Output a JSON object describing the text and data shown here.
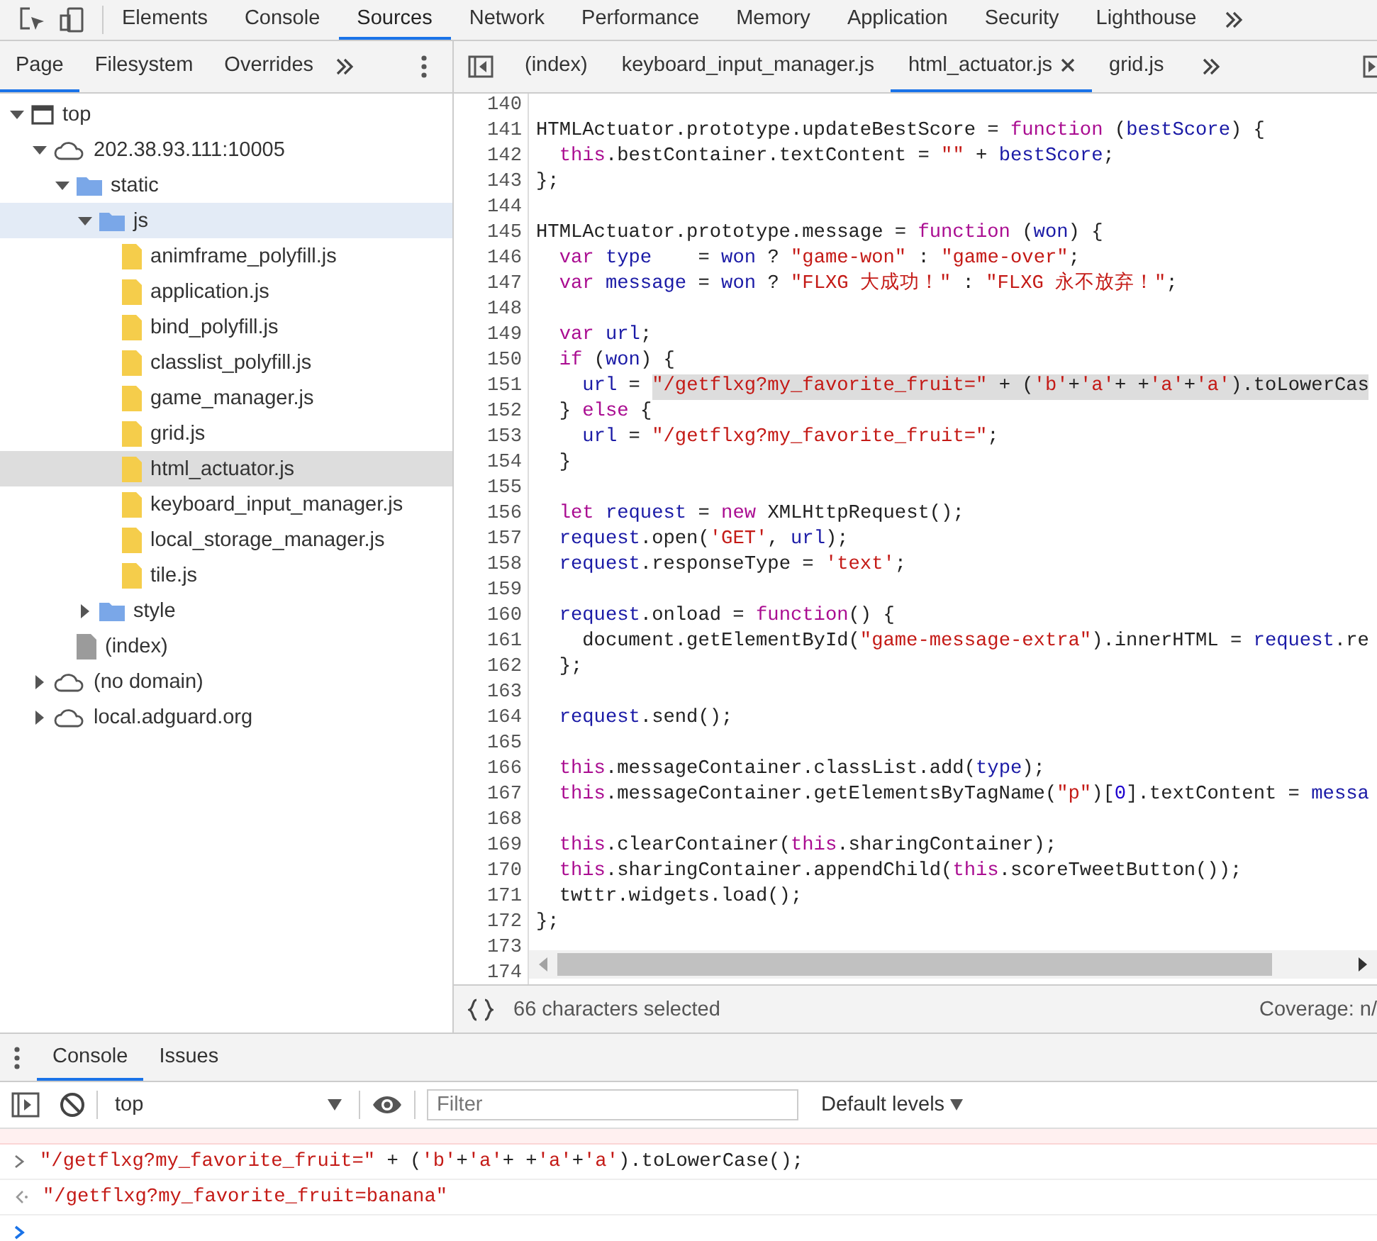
{
  "toolbar": {
    "tabs": [
      {
        "label": "Elements",
        "selected": false
      },
      {
        "label": "Console",
        "selected": false
      },
      {
        "label": "Sources",
        "selected": true
      },
      {
        "label": "Network",
        "selected": false
      },
      {
        "label": "Performance",
        "selected": false
      },
      {
        "label": "Memory",
        "selected": false
      },
      {
        "label": "Application",
        "selected": false
      },
      {
        "label": "Security",
        "selected": false
      },
      {
        "label": "Lighthouse",
        "selected": false
      }
    ]
  },
  "navigator": {
    "tabs": [
      {
        "label": "Page",
        "selected": true
      },
      {
        "label": "Filesystem",
        "selected": false
      },
      {
        "label": "Overrides",
        "selected": false
      }
    ],
    "tree": [
      {
        "label": "top",
        "kind": "frame",
        "expanded": true,
        "selected": false,
        "highlighted": false,
        "children": [
          {
            "label": "202.38.93.111:10005",
            "kind": "domain",
            "expanded": true,
            "selected": false,
            "highlighted": false,
            "children": [
              {
                "label": "static",
                "kind": "folder",
                "expanded": true,
                "selected": false,
                "highlighted": false,
                "children": [
                  {
                    "label": "js",
                    "kind": "folder",
                    "expanded": true,
                    "selected": false,
                    "highlighted": true,
                    "children": [
                      {
                        "label": "animframe_polyfill.js",
                        "kind": "file",
                        "selected": false,
                        "highlighted": false
                      },
                      {
                        "label": "application.js",
                        "kind": "file",
                        "selected": false,
                        "highlighted": false
                      },
                      {
                        "label": "bind_polyfill.js",
                        "kind": "file",
                        "selected": false,
                        "highlighted": false
                      },
                      {
                        "label": "classlist_polyfill.js",
                        "kind": "file",
                        "selected": false,
                        "highlighted": false
                      },
                      {
                        "label": "game_manager.js",
                        "kind": "file",
                        "selected": false,
                        "highlighted": false
                      },
                      {
                        "label": "grid.js",
                        "kind": "file",
                        "selected": false,
                        "highlighted": false
                      },
                      {
                        "label": "html_actuator.js",
                        "kind": "file",
                        "selected": true,
                        "highlighted": false
                      },
                      {
                        "label": "keyboard_input_manager.js",
                        "kind": "file",
                        "selected": false,
                        "highlighted": false
                      },
                      {
                        "label": "local_storage_manager.js",
                        "kind": "file",
                        "selected": false,
                        "highlighted": false
                      },
                      {
                        "label": "tile.js",
                        "kind": "file",
                        "selected": false,
                        "highlighted": false
                      }
                    ]
                  },
                  {
                    "label": "style",
                    "kind": "folder",
                    "expanded": false,
                    "selected": false,
                    "highlighted": false
                  }
                ]
              },
              {
                "label": "(index)",
                "kind": "document",
                "selected": false,
                "highlighted": false
              }
            ]
          },
          {
            "label": "(no domain)",
            "kind": "domain",
            "expanded": false,
            "selected": false,
            "highlighted": false
          },
          {
            "label": "local.adguard.org",
            "kind": "domain",
            "expanded": false,
            "selected": false,
            "highlighted": false
          }
        ]
      }
    ]
  },
  "editor": {
    "tabs": [
      {
        "label": "(index)",
        "selected": false
      },
      {
        "label": "keyboard_input_manager.js",
        "selected": false
      },
      {
        "label": "html_actuator.js",
        "selected": true
      },
      {
        "label": "grid.js",
        "selected": false
      }
    ],
    "lines": [
      {
        "number": "140"
      },
      {
        "number": "141",
        "tokens": [
          {
            "kind": "plain",
            "text": "HTMLActuator.prototype.updateBestScore = "
          },
          {
            "kind": "keyword",
            "text": "function"
          },
          {
            "kind": "plain",
            "text": " ("
          },
          {
            "kind": "name",
            "text": "bestScore"
          },
          {
            "kind": "plain",
            "text": ") {"
          }
        ]
      },
      {
        "number": "142",
        "tokens": [
          {
            "kind": "keyword",
            "text": "  this"
          },
          {
            "kind": "plain",
            "text": ".bestContainer.textContent = "
          },
          {
            "kind": "string",
            "text": "\"\""
          },
          {
            "kind": "plain",
            "text": " + "
          },
          {
            "kind": "name",
            "text": "bestScore"
          },
          {
            "kind": "plain",
            "text": ";"
          }
        ]
      },
      {
        "number": "143",
        "tokens": [
          {
            "kind": "plain",
            "text": "};"
          }
        ]
      },
      {
        "number": "144"
      },
      {
        "number": "145",
        "tokens": [
          {
            "kind": "plain",
            "text": "HTMLActuator.prototype.message = "
          },
          {
            "kind": "keyword",
            "text": "function"
          },
          {
            "kind": "plain",
            "text": " ("
          },
          {
            "kind": "name",
            "text": "won"
          },
          {
            "kind": "plain",
            "text": ") {"
          }
        ]
      },
      {
        "number": "146",
        "tokens": [
          {
            "kind": "keyword",
            "text": "  var"
          },
          {
            "kind": "name",
            "text": " type"
          },
          {
            "kind": "plain",
            "text": "    = "
          },
          {
            "kind": "name",
            "text": "won"
          },
          {
            "kind": "plain",
            "text": " ? "
          },
          {
            "kind": "string",
            "text": "\"game-won\""
          },
          {
            "kind": "plain",
            "text": " : "
          },
          {
            "kind": "string",
            "text": "\"game-over\""
          },
          {
            "kind": "plain",
            "text": ";"
          }
        ]
      },
      {
        "number": "147",
        "tokens": [
          {
            "kind": "keyword",
            "text": "  var"
          },
          {
            "kind": "name",
            "text": " message"
          },
          {
            "kind": "plain",
            "text": " = "
          },
          {
            "kind": "name",
            "text": "won"
          },
          {
            "kind": "plain",
            "text": " ? "
          },
          {
            "kind": "string",
            "text": "\"FLXG 大成功！\""
          },
          {
            "kind": "plain",
            "text": " : "
          },
          {
            "kind": "string",
            "text": "\"FLXG 永不放弃！\""
          },
          {
            "kind": "plain",
            "text": ";"
          }
        ]
      },
      {
        "number": "148"
      },
      {
        "number": "149",
        "tokens": [
          {
            "kind": "keyword",
            "text": "  var"
          },
          {
            "kind": "name",
            "text": " url"
          },
          {
            "kind": "plain",
            "text": ";"
          }
        ]
      },
      {
        "number": "150",
        "tokens": [
          {
            "kind": "keyword",
            "text": "  if"
          },
          {
            "kind": "plain",
            "text": " ("
          },
          {
            "kind": "name",
            "text": "won"
          },
          {
            "kind": "plain",
            "text": ") {"
          }
        ]
      },
      {
        "number": "151",
        "tokens": [
          {
            "kind": "name",
            "text": "    url"
          },
          {
            "kind": "plain",
            "text": " = "
          }
        ],
        "selected_tokens": [
          {
            "kind": "string",
            "text": "\"/getflxg?my_favorite_fruit=\""
          },
          {
            "kind": "plain",
            "text": " + ("
          },
          {
            "kind": "string",
            "text": "'b'"
          },
          {
            "kind": "plain",
            "text": "+"
          },
          {
            "kind": "string",
            "text": "'a'"
          },
          {
            "kind": "plain",
            "text": "+ +"
          },
          {
            "kind": "string",
            "text": "'a'"
          },
          {
            "kind": "plain",
            "text": "+"
          },
          {
            "kind": "string",
            "text": "'a'"
          },
          {
            "kind": "plain",
            "text": ").toLowerCas"
          }
        ]
      },
      {
        "number": "152",
        "tokens": [
          {
            "kind": "plain",
            "text": "  } "
          },
          {
            "kind": "keyword",
            "text": "else"
          },
          {
            "kind": "plain",
            "text": " {"
          }
        ]
      },
      {
        "number": "153",
        "tokens": [
          {
            "kind": "name",
            "text": "    url"
          },
          {
            "kind": "plain",
            "text": " = "
          },
          {
            "kind": "string",
            "text": "\"/getflxg?my_favorite_fruit=\""
          },
          {
            "kind": "plain",
            "text": ";"
          }
        ]
      },
      {
        "number": "154",
        "tokens": [
          {
            "kind": "plain",
            "text": "  }"
          }
        ]
      },
      {
        "number": "155"
      },
      {
        "number": "156",
        "tokens": [
          {
            "kind": "keyword",
            "text": "  let"
          },
          {
            "kind": "name",
            "text": " request"
          },
          {
            "kind": "plain",
            "text": " = "
          },
          {
            "kind": "keyword",
            "text": "new"
          },
          {
            "kind": "plain",
            "text": " XMLHttpRequest();"
          }
        ]
      },
      {
        "number": "157",
        "tokens": [
          {
            "kind": "name",
            "text": "  request"
          },
          {
            "kind": "plain",
            "text": ".open("
          },
          {
            "kind": "string",
            "text": "'GET'"
          },
          {
            "kind": "plain",
            "text": ", "
          },
          {
            "kind": "name",
            "text": "url"
          },
          {
            "kind": "plain",
            "text": ");"
          }
        ]
      },
      {
        "number": "158",
        "tokens": [
          {
            "kind": "name",
            "text": "  request"
          },
          {
            "kind": "plain",
            "text": ".responseType = "
          },
          {
            "kind": "string",
            "text": "'text'"
          },
          {
            "kind": "plain",
            "text": ";"
          }
        ]
      },
      {
        "number": "159"
      },
      {
        "number": "160",
        "tokens": [
          {
            "kind": "name",
            "text": "  request"
          },
          {
            "kind": "plain",
            "text": ".onload = "
          },
          {
            "kind": "keyword",
            "text": "function"
          },
          {
            "kind": "plain",
            "text": "() {"
          }
        ]
      },
      {
        "number": "161",
        "tokens": [
          {
            "kind": "plain",
            "text": "    document.getElementById("
          },
          {
            "kind": "string",
            "text": "\"game-message-extra\""
          },
          {
            "kind": "plain",
            "text": ").innerHTML = "
          },
          {
            "kind": "name",
            "text": "request"
          },
          {
            "kind": "plain",
            "text": ".re"
          }
        ]
      },
      {
        "number": "162",
        "tokens": [
          {
            "kind": "plain",
            "text": "  };"
          }
        ]
      },
      {
        "number": "163"
      },
      {
        "number": "164",
        "tokens": [
          {
            "kind": "name",
            "text": "  request"
          },
          {
            "kind": "plain",
            "text": ".send();"
          }
        ]
      },
      {
        "number": "165"
      },
      {
        "number": "166",
        "tokens": [
          {
            "kind": "keyword",
            "text": "  this"
          },
          {
            "kind": "plain",
            "text": ".messageContainer.classList.add("
          },
          {
            "kind": "name",
            "text": "type"
          },
          {
            "kind": "plain",
            "text": ");"
          }
        ]
      },
      {
        "number": "167",
        "tokens": [
          {
            "kind": "keyword",
            "text": "  this"
          },
          {
            "kind": "plain",
            "text": ".messageContainer.getElementsByTagName("
          },
          {
            "kind": "string",
            "text": "\"p\""
          },
          {
            "kind": "plain",
            "text": ")["
          },
          {
            "kind": "number",
            "text": "0"
          },
          {
            "kind": "plain",
            "text": "].textContent = "
          },
          {
            "kind": "name",
            "text": "messa"
          }
        ]
      },
      {
        "number": "168"
      },
      {
        "number": "169",
        "tokens": [
          {
            "kind": "keyword",
            "text": "  this"
          },
          {
            "kind": "plain",
            "text": ".clearContainer("
          },
          {
            "kind": "keyword",
            "text": "this"
          },
          {
            "kind": "plain",
            "text": ".sharingContainer);"
          }
        ]
      },
      {
        "number": "170",
        "tokens": [
          {
            "kind": "keyword",
            "text": "  this"
          },
          {
            "kind": "plain",
            "text": ".sharingContainer.appendChild("
          },
          {
            "kind": "keyword",
            "text": "this"
          },
          {
            "kind": "plain",
            "text": ".scoreTweetButton());"
          }
        ]
      },
      {
        "number": "171",
        "tokens": [
          {
            "kind": "plain",
            "text": "  twttr.widgets.load();"
          }
        ]
      },
      {
        "number": "172",
        "tokens": [
          {
            "kind": "plain",
            "text": "};"
          }
        ]
      },
      {
        "number": "173"
      },
      {
        "number": "174"
      }
    ],
    "status": "66 characters selected",
    "coverage": "Coverage: n/"
  },
  "drawer": {
    "tabs": [
      {
        "label": "Console",
        "selected": true
      },
      {
        "label": "Issues",
        "selected": false
      }
    ],
    "context": "top",
    "filter_placeholder": "Filter",
    "levels": "Default levels",
    "messages": [
      {
        "kind": "input",
        "tokens": [
          {
            "kind": "string",
            "text": "\"/getflxg?my_favorite_fruit=\""
          },
          {
            "kind": "plain",
            "text": " + ("
          },
          {
            "kind": "string",
            "text": "'b'"
          },
          {
            "kind": "plain",
            "text": "+"
          },
          {
            "kind": "string",
            "text": "'a'"
          },
          {
            "kind": "plain",
            "text": "+ +"
          },
          {
            "kind": "string",
            "text": "'a'"
          },
          {
            "kind": "plain",
            "text": "+"
          },
          {
            "kind": "string",
            "text": "'a'"
          },
          {
            "kind": "plain",
            "text": ").toLowerCase();"
          }
        ]
      },
      {
        "kind": "result",
        "tokens": [
          {
            "kind": "string",
            "text": "\"/getflxg?my_favorite_fruit=banana\""
          }
        ]
      }
    ]
  }
}
